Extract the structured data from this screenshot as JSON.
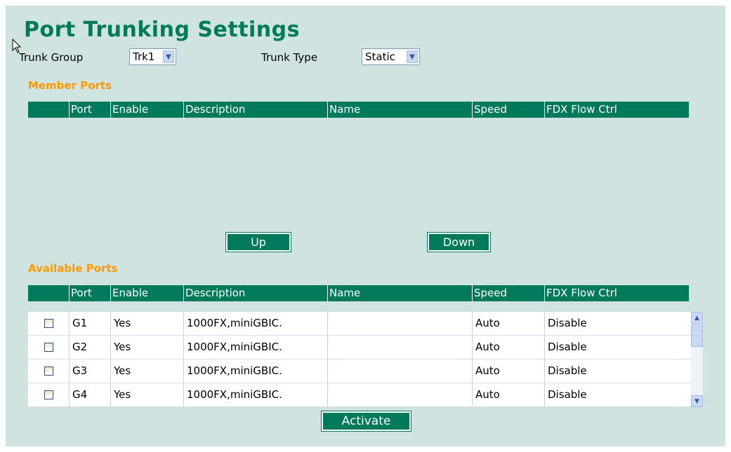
{
  "page": {
    "title": "Port Trunking Settings"
  },
  "trunk_group": {
    "label": "Trunk Group",
    "value": "Trk1"
  },
  "trunk_type": {
    "label": "Trunk Type",
    "value": "Static"
  },
  "member_ports": {
    "heading": "Member Ports",
    "columns": [
      "",
      "Port",
      "Enable",
      "Description",
      "Name",
      "Speed",
      "FDX Flow Ctrl"
    ],
    "rows": []
  },
  "buttons": {
    "up": "Up",
    "down": "Down",
    "activate": "Activate"
  },
  "available_ports": {
    "heading": "Available Ports",
    "columns": [
      "",
      "Port",
      "Enable",
      "Description",
      "Name",
      "Speed",
      "FDX Flow Ctrl"
    ],
    "rows": [
      {
        "port": "G1",
        "enable": "Yes",
        "description": "1000FX,miniGBIC.",
        "name": "",
        "speed": "Auto",
        "fdx": "Disable"
      },
      {
        "port": "G2",
        "enable": "Yes",
        "description": "1000FX,miniGBIC.",
        "name": "",
        "speed": "Auto",
        "fdx": "Disable"
      },
      {
        "port": "G3",
        "enable": "Yes",
        "description": "1000FX,miniGBIC.",
        "name": "",
        "speed": "Auto",
        "fdx": "Disable"
      },
      {
        "port": "G4",
        "enable": "Yes",
        "description": "1000FX,miniGBIC.",
        "name": "",
        "speed": "Auto",
        "fdx": "Disable"
      }
    ]
  },
  "icons": {
    "cursor": "mouse-pointer-icon",
    "dropdown": "chevron-down-icon",
    "scroll_up": "chevron-up-icon",
    "scroll_down": "chevron-down-icon"
  },
  "colors": {
    "background": "#cfe4e1",
    "accent": "#007a5a",
    "section_heading": "#ff9900"
  }
}
